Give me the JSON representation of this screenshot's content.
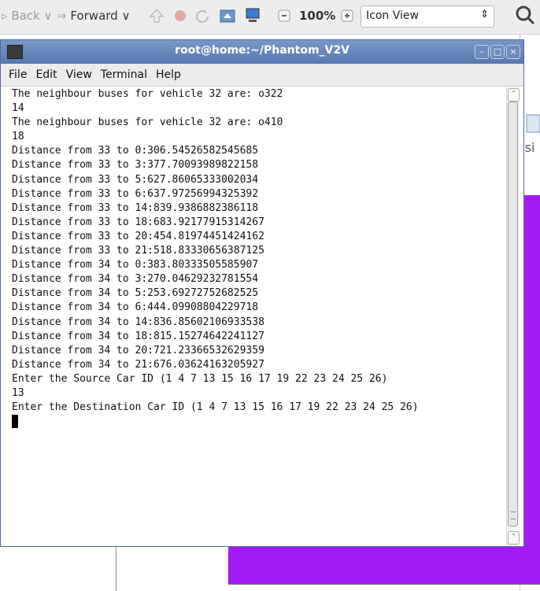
{
  "toolbar": {
    "back_label": "Back",
    "forward_label": "Forward",
    "zoom_value": "100%",
    "view_mode": "Icon View",
    "icons": [
      "back-arrow-icon",
      "forward-arrow-icon",
      "up-arrow-icon",
      "stop-icon",
      "reload-icon",
      "home-folder-icon",
      "computer-icon",
      "zoom-out-icon",
      "zoom-in-icon",
      "search-icon"
    ]
  },
  "background": {
    "partial_label": "Jsi",
    "accent_color": "#a31bf2"
  },
  "terminal": {
    "title": "root@home:~/Phantom_V2V",
    "menu": [
      "File",
      "Edit",
      "View",
      "Terminal",
      "Help"
    ],
    "lines": [
      "The neighbour buses for vehicle 32 are: o322",
      "14",
      "The neighbour buses for vehicle 32 are: o410",
      "18",
      "Distance from 33 to 0:306.54526582545685",
      "Distance from 33 to 3:377.70093989822158",
      "Distance from 33 to 5:627.86065333002034",
      "Distance from 33 to 6:637.97256994325392",
      "Distance from 33 to 14:839.9386882386118",
      "Distance from 33 to 18:683.92177915314267",
      "Distance from 33 to 20:454.81974451424162",
      "Distance from 33 to 21:518.83330656387125",
      "Distance from 34 to 0:383.80333505585907",
      "Distance from 34 to 3:270.04629232781554",
      "Distance from 34 to 5:253.69272752682525",
      "Distance from 34 to 6:444.09908804229718",
      "Distance from 34 to 14:836.85602106933538",
      "Distance from 34 to 18:815.15274642241127",
      "Distance from 34 to 20:721.23366532629359",
      "Distance from 34 to 21:676.03624163205927",
      "Enter the Source Car ID (1 4 7 13 15 16 17 19 22 23 24 25 26)",
      "13",
      "Enter the Destination Car ID (1 4 7 13 15 16 17 19 22 23 24 25 26)"
    ],
    "window_buttons": [
      "minimize-icon",
      "maximize-icon",
      "close-icon"
    ]
  }
}
